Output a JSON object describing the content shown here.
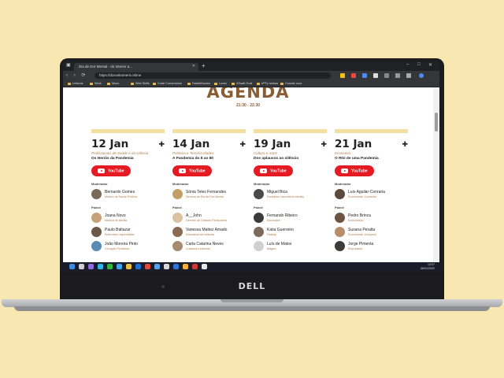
{
  "browser": {
    "tab_title": "Dia de Dor Mental - do Interior a...",
    "url": "https://doroeboment.online",
    "bookmarks": [
      "Leituras",
      "Work",
      "Moov",
      "Web Skills",
      "Code Cornerstone",
      "Data&Muzica",
      "Lovec",
      "ATwatt Gost",
      "ePTy ambas",
      "Crowdz roos"
    ]
  },
  "page": {
    "title": "AGENDA",
    "time": "21:30 - 22:30",
    "moderator_label": "Moderador",
    "panel_label": "Painel",
    "youtube_label": "YouTube",
    "days": [
      {
        "date": "12 Jan",
        "subtitle": "Profissionais de Saúde e da Ciência",
        "topic": "Os Heróis da Pandemia",
        "moderator": {
          "name": "Bernardo Gomes",
          "role": "Médico de Saúde Pública"
        },
        "panel": [
          {
            "name": "Joana Novo",
            "role": "Médica de família"
          },
          {
            "name": "Paulo Baltazar",
            "role": "Enfermeiro especialista"
          },
          {
            "name": "João Moreira Pinto",
            "role": "Cirurgião Pediátrico"
          }
        ]
      },
      {
        "date": "14 Jan",
        "subtitle": "Primeira e Terceira Idades",
        "topic": "A Pandemia do 8 ao 80",
        "moderator": {
          "name": "Sónia Teles Fernandes",
          "role": "Diretora do Dia de Dor Mental"
        },
        "panel": [
          {
            "name": "A__John",
            "role": "Gerente de Cidades Particulares"
          },
          {
            "name": "Vanessa Mattez Amado",
            "role": "Educadora de Infância"
          },
          {
            "name": "Carla Catarina Neves",
            "role": "Cuidadora Informal"
          }
        ]
      },
      {
        "date": "19 Jan",
        "subtitle": "Cultura e Artes",
        "topic": "Dos aplausos ao silêncio",
        "moderator": {
          "name": "Miguel Bica",
          "role": "Fundador Laboratório Identity"
        },
        "panel": [
          {
            "name": "Fernando Ribeiro",
            "role": "Moonspell"
          },
          {
            "name": "Katia Guerreiro",
            "role": "Fadista"
          },
          {
            "name": "Luís de Matos",
            "role": "Mágico"
          }
        ]
      },
      {
        "date": "21 Jan",
        "subtitle": "Economia",
        "topic": "O RGI de uma Pandemia",
        "moderator": {
          "name": "Luís Aguilar-Conraria",
          "role": "Economista, Consultor"
        },
        "panel": [
          {
            "name": "Pedro Brinca",
            "role": "Economista"
          },
          {
            "name": "Susana Peralta",
            "role": "Economista, Zeroperio"
          },
          {
            "name": "Jorge Pimenta",
            "role": "Empresário"
          }
        ]
      }
    ]
  },
  "taskbar": {
    "time": "13:07",
    "date": "06/01/2022"
  },
  "device": {
    "brand": "DELL"
  },
  "colors": {
    "accent_brown": "#8a5d35",
    "youtube_red": "#e41b23",
    "background_yellow": "#f8e7b0",
    "bar_yellow": "#f5dfa0"
  }
}
